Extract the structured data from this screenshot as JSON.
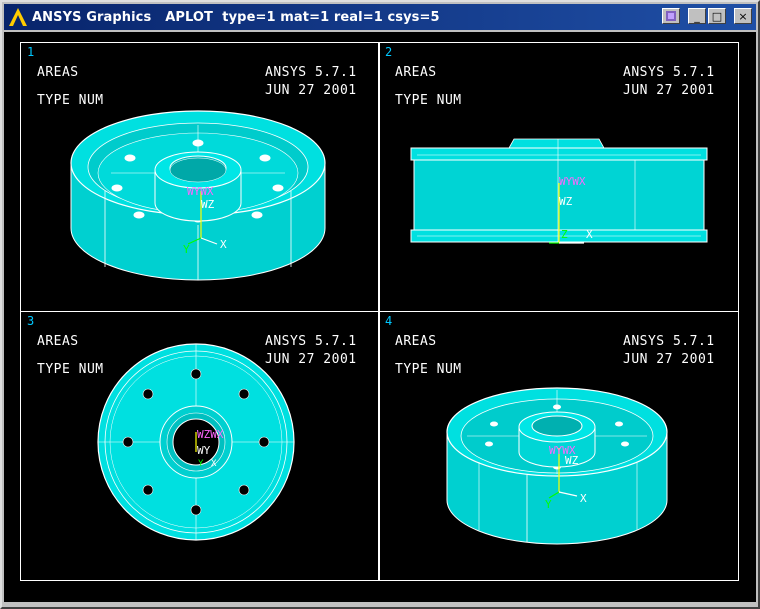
{
  "window": {
    "title": "ANSYS Graphics   APLOT  type=1 mat=1 real=1 csys=5"
  },
  "titlebar_buttons": {
    "minimize": "_",
    "maximize": "□",
    "close": "×"
  },
  "viewports": [
    {
      "number": "1",
      "label1": "AREAS",
      "label2": "TYPE NUM",
      "version": "ANSYS 5.7.1",
      "date": "JUN 27 2001",
      "axes": {
        "a": "WYWX",
        "b": "WZ",
        "c": "Y",
        "d": "X"
      }
    },
    {
      "number": "2",
      "label1": "AREAS",
      "label2": "TYPE NUM",
      "version": "ANSYS 5.7.1",
      "date": "JUN 27 2001",
      "axes": {
        "a": "WYWX",
        "b": "WZ",
        "c": "Z",
        "d": "X"
      }
    },
    {
      "number": "3",
      "label1": "AREAS",
      "label2": "TYPE NUM",
      "version": "ANSYS 5.7.1",
      "date": "JUN 27 2001",
      "axes": {
        "a": "WZWX",
        "b": "WY",
        "c": "Y",
        "d": "X"
      }
    },
    {
      "number": "4",
      "label1": "AREAS",
      "label2": "TYPE NUM",
      "version": "ANSYS 5.7.1",
      "date": "JUN 27 2001",
      "axes": {
        "a": "WYWX",
        "b": "WZ",
        "c": "Y",
        "d": "X"
      }
    }
  ],
  "colors": {
    "model": "#00e6e6",
    "edge": "#ffffff",
    "background": "#000000",
    "titlebar": "#08246b"
  }
}
